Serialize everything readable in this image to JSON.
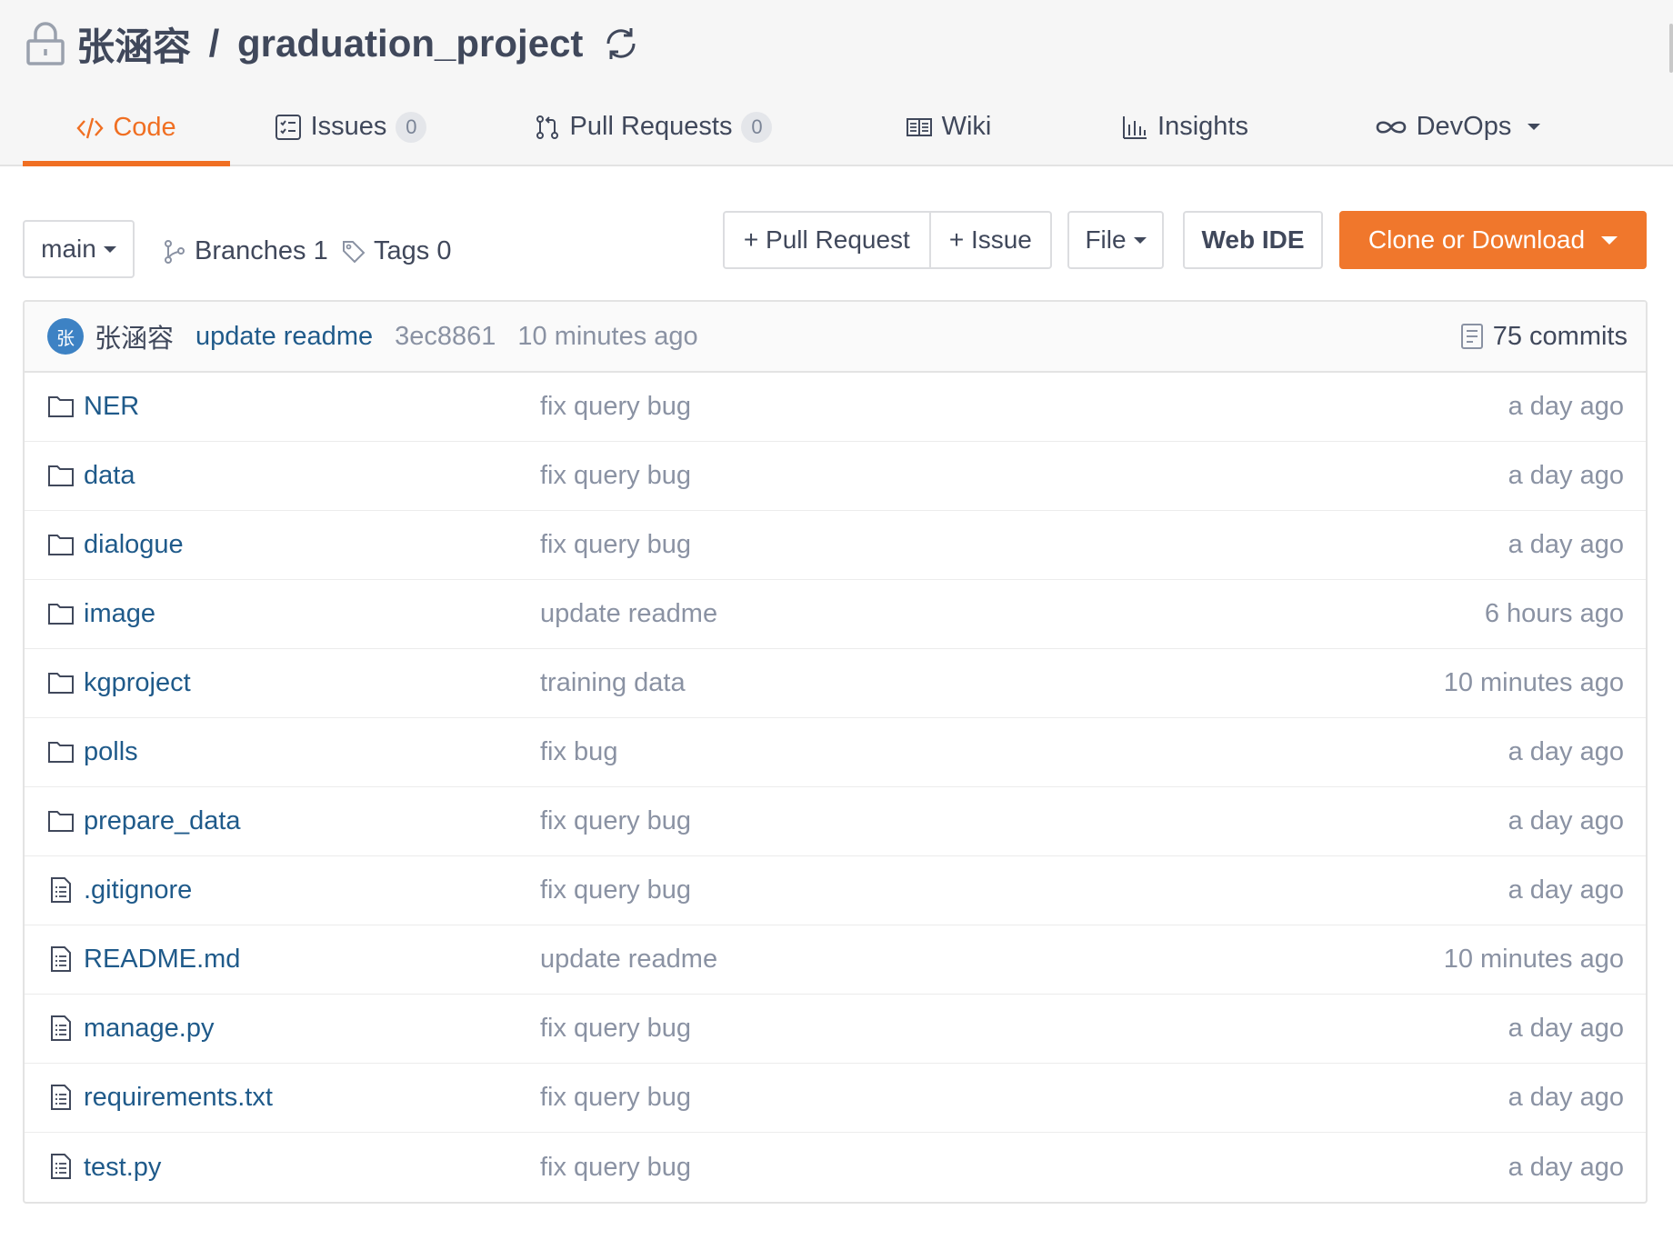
{
  "repo": {
    "owner": "张涵容",
    "separator": " / ",
    "name": "graduation_project",
    "private_icon": "lock-icon",
    "status_icon": "sync-icon"
  },
  "tabs": [
    {
      "label": "Code",
      "icon": "code-icon",
      "active": true
    },
    {
      "label": "Issues",
      "icon": "issues-icon",
      "count": "0"
    },
    {
      "label": "Pull Requests",
      "icon": "pull-request-icon",
      "count": "0"
    },
    {
      "label": "Wiki",
      "icon": "wiki-icon"
    },
    {
      "label": "Insights",
      "icon": "insights-icon"
    },
    {
      "label": "DevOps",
      "icon": "infinity-icon",
      "dropdown": true
    }
  ],
  "toolbar": {
    "branch": "main",
    "branches_label": "Branches 1",
    "tags_label": "Tags 0",
    "pull_request_label": "+ Pull Request",
    "issue_label": "+ Issue",
    "file_label": "File",
    "web_ide_label": "Web IDE",
    "clone_label": "Clone or Download"
  },
  "latest_commit": {
    "avatar_text": "张",
    "author": "张涵容",
    "message": "update readme",
    "sha": "3ec8861",
    "time": "10 minutes ago",
    "commits_label": "75 commits"
  },
  "files": [
    {
      "name": "NER",
      "type": "folder",
      "message": "fix query bug",
      "time": "a day ago"
    },
    {
      "name": "data",
      "type": "folder",
      "message": "fix query bug",
      "time": "a day ago"
    },
    {
      "name": "dialogue",
      "type": "folder",
      "message": "fix query bug",
      "time": "a day ago"
    },
    {
      "name": "image",
      "type": "folder",
      "message": "update readme",
      "time": "6 hours ago"
    },
    {
      "name": "kgproject",
      "type": "folder",
      "message": "training data",
      "time": "10 minutes ago"
    },
    {
      "name": "polls",
      "type": "folder",
      "message": "fix bug",
      "time": "a day ago"
    },
    {
      "name": "prepare_data",
      "type": "folder",
      "message": "fix query bug",
      "time": "a day ago"
    },
    {
      "name": ".gitignore",
      "type": "file",
      "message": "fix query bug",
      "time": "a day ago"
    },
    {
      "name": "README.md",
      "type": "file",
      "message": "update readme",
      "time": "10 minutes ago"
    },
    {
      "name": "manage.py",
      "type": "file",
      "message": "fix query bug",
      "time": "a day ago"
    },
    {
      "name": "requirements.txt",
      "type": "file",
      "message": "fix query bug",
      "time": "a day ago"
    },
    {
      "name": "test.py",
      "type": "file",
      "message": "fix query bug",
      "time": "a day ago"
    }
  ],
  "colors": {
    "accent": "#f06f22",
    "link": "#1f5a8a",
    "muted": "#8a92a3",
    "text": "#40485b"
  }
}
